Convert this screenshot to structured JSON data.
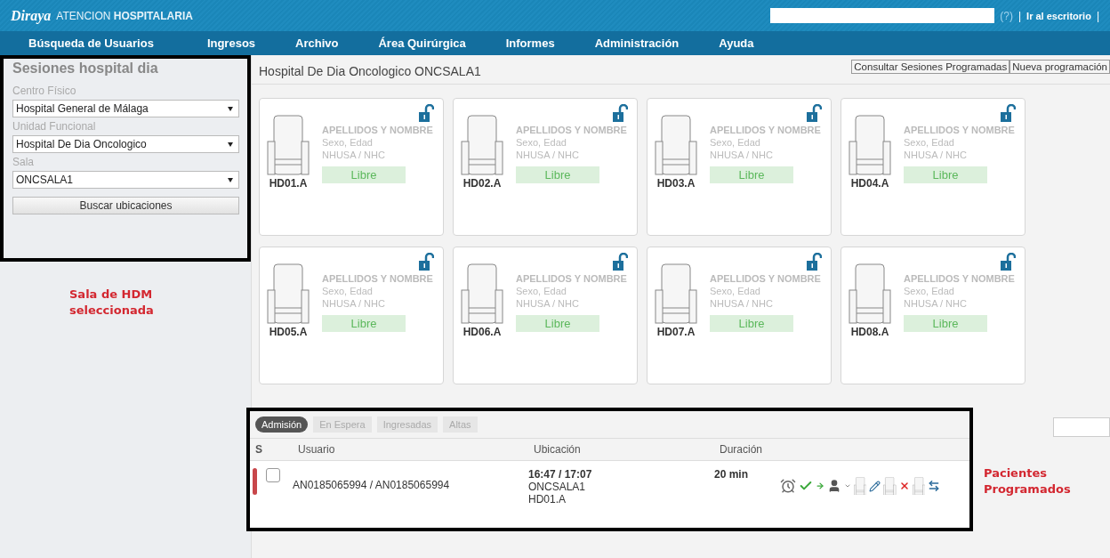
{
  "header": {
    "logo": "Diraya",
    "title": "ATENCION **HOSPITALARIA**",
    "help": "(?)",
    "separators": [
      "|",
      "|"
    ],
    "desktop_link": "Ir al escritorio"
  },
  "nav": [
    "Búsqueda de Usuarios",
    "Ingresos",
    "Archivo",
    "Área Quirúrgica",
    "Informes",
    "Administración",
    "Ayuda"
  ],
  "sidebar": {
    "title": "Sesiones hospital dia",
    "fields": [
      {
        "label": "Centro Físico",
        "value": "Hospital General de Málaga"
      },
      {
        "label": "Unidad Funcional",
        "value": "Hospital De Dia Oncologico"
      },
      {
        "label": "Sala",
        "value": "ONCSALA1"
      }
    ],
    "button": "Buscar ubicaciones"
  },
  "annotations": [
    {
      "text": "Sala de HDM seleccionada"
    },
    {
      "text": "Pacientes Programados"
    }
  ],
  "main": {
    "title": "Hospital De Dia Oncologico ONCSALA1",
    "buttons": [
      "Consultar Sesiones Programadas",
      "Nueva programación"
    ],
    "beds": [
      {
        "code": "HD01.A",
        "name": "APELLIDOS Y NOMBRE",
        "sex_age": "Sexo, Edad",
        "ids": "NHUSA / NHC",
        "status": "Libre"
      },
      {
        "code": "HD02.A",
        "name": "APELLIDOS Y NOMBRE",
        "sex_age": "Sexo, Edad",
        "ids": "NHUSA / NHC",
        "status": "Libre"
      },
      {
        "code": "HD03.A",
        "name": "APELLIDOS Y NOMBRE",
        "sex_age": "Sexo, Edad",
        "ids": "NHUSA / NHC",
        "status": "Libre"
      },
      {
        "code": "HD04.A",
        "name": "APELLIDOS Y NOMBRE",
        "sex_age": "Sexo, Edad",
        "ids": "NHUSA / NHC",
        "status": "Libre"
      },
      {
        "code": "HD05.A",
        "name": "APELLIDOS Y NOMBRE",
        "sex_age": "Sexo, Edad",
        "ids": "NHUSA / NHC",
        "status": "Libre"
      },
      {
        "code": "HD06.A",
        "name": "APELLIDOS Y NOMBRE",
        "sex_age": "Sexo, Edad",
        "ids": "NHUSA / NHC",
        "status": "Libre"
      },
      {
        "code": "HD07.A",
        "name": "APELLIDOS Y NOMBRE",
        "sex_age": "Sexo, Edad",
        "ids": "NHUSA / NHC",
        "status": "Libre"
      },
      {
        "code": "HD08.A",
        "name": "APELLIDOS Y NOMBRE",
        "sex_age": "Sexo, Edad",
        "ids": "NHUSA / NHC",
        "status": "Libre"
      }
    ]
  },
  "patients": {
    "tabs": [
      {
        "label": "Admisión",
        "selected": true
      },
      {
        "label": "En Espera",
        "selected": false
      },
      {
        "label": "Ingresadas",
        "selected": false
      },
      {
        "label": "Altas",
        "selected": false
      }
    ],
    "columns": [
      "S",
      "Usuario",
      "Ubicación",
      "Duración"
    ],
    "rows": [
      {
        "color": "#c8464a",
        "checked": false,
        "ids": "AN0185065994 / AN0185065994",
        "time": "16:47 / 17:07",
        "room": "ONCSALA1",
        "bed": "HD01.A",
        "duration": "20 min"
      }
    ]
  }
}
